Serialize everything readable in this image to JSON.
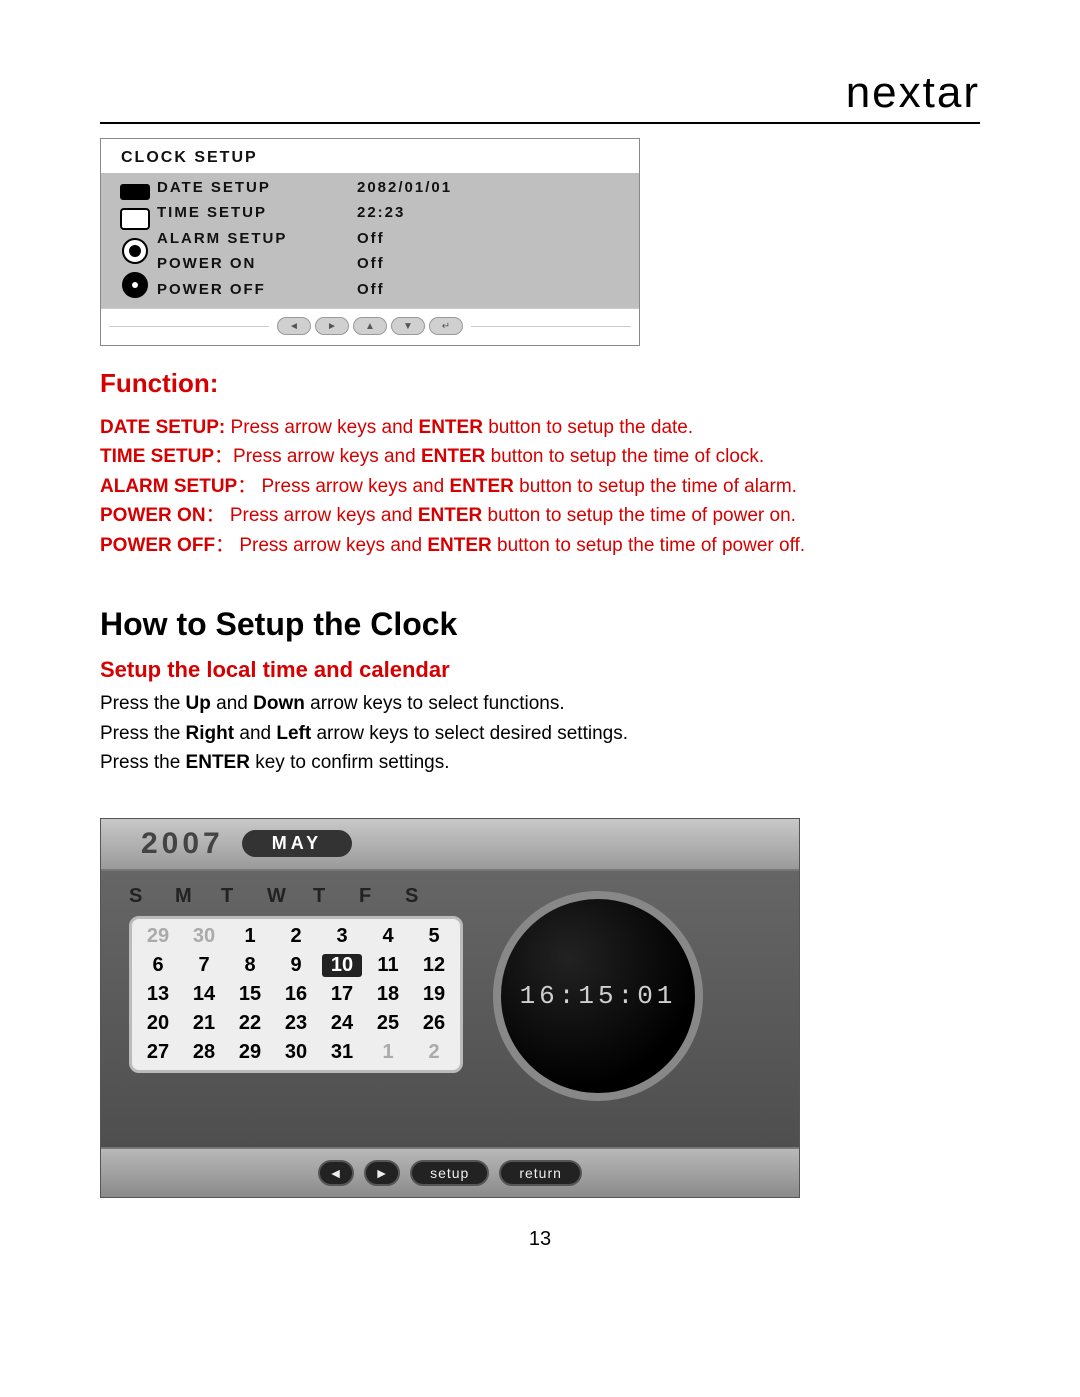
{
  "brand": "nextar",
  "clock_setup": {
    "title": "CLOCK SETUP",
    "rows": [
      {
        "label": "DATE SETUP",
        "value": "2082/01/01"
      },
      {
        "label": "TIME SETUP",
        "value": "22:23"
      },
      {
        "label": "ALARM SETUP",
        "value": "Off"
      },
      {
        "label": "POWER ON",
        "value": "Off"
      },
      {
        "label": "POWER OFF",
        "value": "Off"
      }
    ],
    "nav_icons": [
      "◄",
      "►",
      "▲",
      "▼",
      "↵"
    ]
  },
  "function": {
    "heading": "Function:",
    "items": [
      {
        "term": "DATE SETUP:",
        "sep": " ",
        "pre": "Press arrow keys and ",
        "bold": "ENTER",
        "post": " button to setup the date."
      },
      {
        "term": "TIME SETUP",
        "sep": "：",
        "pre": "Press arrow keys and ",
        "bold": "ENTER",
        "post": " button to setup the time of clock."
      },
      {
        "term": "ALARM SETUP",
        "sep": "：   ",
        "pre": "Press arrow keys and ",
        "bold": "ENTER",
        "post": " button to setup the time of alarm."
      },
      {
        "term": "POWER ON",
        "sep": "：   ",
        "pre": "Press arrow keys and ",
        "bold": "ENTER",
        "post": " button to setup the time of power on."
      },
      {
        "term": "POWER OFF",
        "sep": "：   ",
        "pre": "Press arrow keys and ",
        "bold": "ENTER",
        "post": " button to setup the time of power off."
      }
    ]
  },
  "howto": {
    "heading": "How to Setup the Clock",
    "subheading": "Setup the local time and calendar",
    "lines": [
      {
        "pre": "Press the ",
        "b1": "Up",
        "mid": " and ",
        "b2": "Down",
        "post": " arrow keys to select functions."
      },
      {
        "pre": "Press the ",
        "b1": "Right",
        "mid": " and ",
        "b2": "Left",
        "post": " arrow keys to select desired settings."
      },
      {
        "pre": "Press the ",
        "b1": "ENTER",
        "mid": "",
        "b2": "",
        "post": " key to confirm settings."
      }
    ]
  },
  "calendar": {
    "year": "2007",
    "month": "MAY",
    "dow": [
      "S",
      "M",
      "T",
      "W",
      "T",
      "F",
      "S"
    ],
    "cells": [
      {
        "t": "29",
        "dim": true
      },
      {
        "t": "30",
        "dim": true
      },
      {
        "t": "1"
      },
      {
        "t": "2"
      },
      {
        "t": "3"
      },
      {
        "t": "4"
      },
      {
        "t": "5"
      },
      {
        "t": "6"
      },
      {
        "t": "7"
      },
      {
        "t": "8"
      },
      {
        "t": "9"
      },
      {
        "t": "10",
        "sel": true
      },
      {
        "t": "11"
      },
      {
        "t": "12"
      },
      {
        "t": "13"
      },
      {
        "t": "14"
      },
      {
        "t": "15"
      },
      {
        "t": "16"
      },
      {
        "t": "17"
      },
      {
        "t": "18"
      },
      {
        "t": "19"
      },
      {
        "t": "20"
      },
      {
        "t": "21"
      },
      {
        "t": "22"
      },
      {
        "t": "23"
      },
      {
        "t": "24"
      },
      {
        "t": "25"
      },
      {
        "t": "26"
      },
      {
        "t": "27"
      },
      {
        "t": "28"
      },
      {
        "t": "29"
      },
      {
        "t": "30"
      },
      {
        "t": "31"
      },
      {
        "t": "1",
        "dim": true
      },
      {
        "t": "2",
        "dim": true
      }
    ],
    "clock_time": "16:15:01",
    "footer": {
      "left": "◄",
      "right": "►",
      "setup": "setup",
      "return": "return"
    }
  },
  "page_number": "13"
}
